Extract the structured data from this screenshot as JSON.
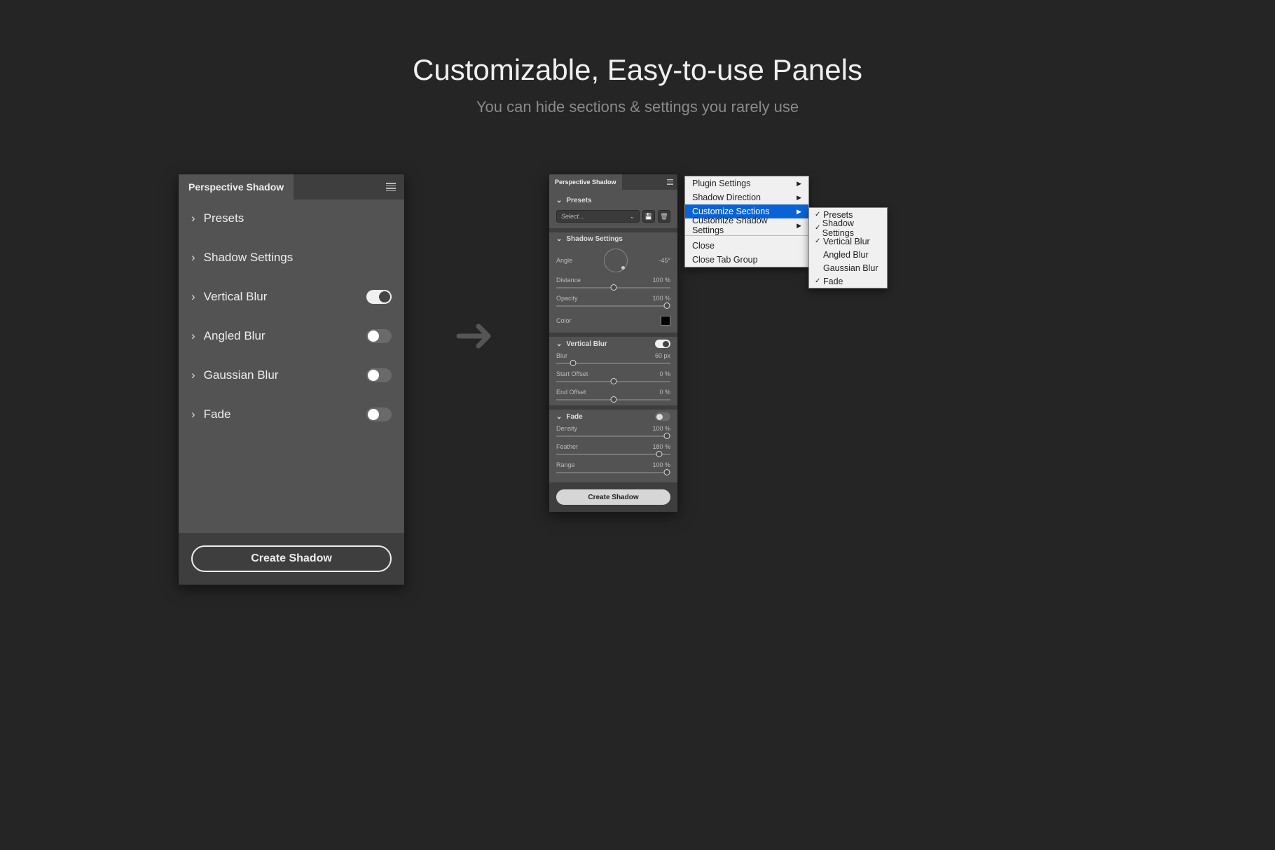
{
  "headline": "Customizable, Easy-to-use Panels",
  "subhead": "You can hide sections & settings you rarely use",
  "panel_left": {
    "title": "Perspective Shadow",
    "rows": {
      "presets": "Presets",
      "shadow_settings": "Shadow Settings",
      "vertical_blur": "Vertical Blur",
      "angled_blur": "Angled Blur",
      "gaussian_blur": "Gaussian Blur",
      "fade": "Fade"
    },
    "create_label": "Create Shadow"
  },
  "panel_right": {
    "title": "Perspective Shadow",
    "presets": {
      "label": "Presets",
      "select_placeholder": "Select..."
    },
    "shadow_settings": {
      "label": "Shadow Settings",
      "angle": {
        "label": "Angle",
        "value": "-45°"
      },
      "distance": {
        "label": "Distance",
        "value": "100 %"
      },
      "opacity": {
        "label": "Opacity",
        "value": "100 %"
      },
      "color": {
        "label": "Color"
      }
    },
    "vertical_blur": {
      "label": "Vertical Blur",
      "blur": {
        "label": "Blur",
        "value": "60 px"
      },
      "start_offset": {
        "label": "Start Offset",
        "value": "0 %"
      },
      "end_offset": {
        "label": "End Offset",
        "value": "0 %"
      }
    },
    "fade": {
      "label": "Fade",
      "density": {
        "label": "Density",
        "value": "100 %"
      },
      "feather": {
        "label": "Feather",
        "value": "180 %"
      },
      "range": {
        "label": "Range",
        "value": "100 %"
      }
    },
    "create_label": "Create Shadow"
  },
  "menu1": {
    "plugin_settings": "Plugin Settings",
    "shadow_direction": "Shadow Direction",
    "customize_sections": "Customize Sections",
    "customize_shadow_settings": "Customize Shadow Settings",
    "close": "Close",
    "close_tab_group": "Close Tab Group"
  },
  "menu2": {
    "presets": "Presets",
    "shadow_settings": "Shadow Settings",
    "vertical_blur": "Vertical Blur",
    "angled_blur": "Angled Blur",
    "gaussian_blur": "Gaussian Blur",
    "fade": "Fade"
  }
}
